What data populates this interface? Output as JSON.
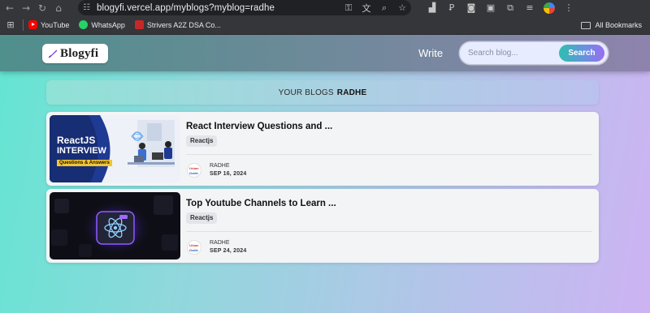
{
  "browser": {
    "url": "blogyfi.vercel.app/myblogs?myblog=radhe",
    "nav_icons": [
      "back-arrow-icon",
      "forward-arrow-icon",
      "reload-icon",
      "home-icon"
    ],
    "bookmarks": [
      {
        "label": "YouTube",
        "icon": "youtube-icon"
      },
      {
        "label": "WhatsApp",
        "icon": "whatsapp-icon"
      },
      {
        "label": "Strivers A2Z DSA Co...",
        "icon": "takeuforward-icon"
      }
    ],
    "all_bookmarks_label": "All Bookmarks"
  },
  "header": {
    "logo_text": "Blogyfi",
    "write_label": "Write",
    "search_placeholder": "Search blog...",
    "search_button_label": "Search"
  },
  "section": {
    "prefix": "YOUR BLOGS",
    "username": "RADHE"
  },
  "blogs": [
    {
      "title": "React Interview Questions and ...",
      "tag": "Reactjs",
      "author": "RADHE",
      "date": "SEP 16, 2024",
      "thumb_line1": "ReactJS",
      "thumb_line2": "INTERVIEW",
      "thumb_line3": "Questions & Answers"
    },
    {
      "title": "Top Youtube Channels to Learn ...",
      "tag": "Reactjs",
      "author": "RADHE",
      "date": "SEP 24, 2024"
    }
  ],
  "avatar_text": {
    "line1": "Urban",
    "line2": "Ozdie"
  },
  "colors": {
    "page_gradient_start": "#63e5d2",
    "page_gradient_end": "#cdb3f3",
    "search_button": "#6c8fe0"
  }
}
